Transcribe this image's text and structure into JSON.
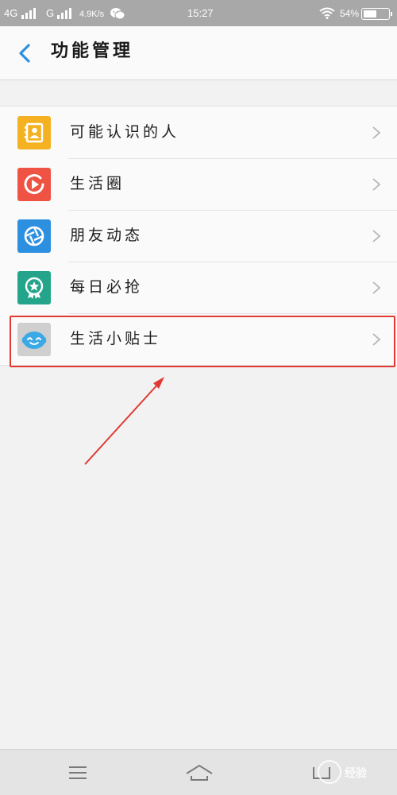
{
  "status_bar": {
    "network1": "4G",
    "network2": "G",
    "speed": "4.9K/s",
    "time": "15:27",
    "battery": "54%",
    "battery_level": 0.54,
    "icons": [
      "signal-icon",
      "signal-icon",
      "wechat-icon",
      "wifi-icon",
      "battery-icon"
    ]
  },
  "header": {
    "back_icon": "chevron-left-icon",
    "title": "功能管理"
  },
  "list": {
    "items": [
      {
        "label": "可能认识的人",
        "icon": "contacts-icon",
        "color": "#f4b223"
      },
      {
        "label": "生活圈",
        "icon": "play-circle-icon",
        "color": "#ee5343"
      },
      {
        "label": "朋友动态",
        "icon": "aperture-icon",
        "color": "#2d8fe0"
      },
      {
        "label": "每日必抢",
        "icon": "badge-star-icon",
        "color": "#24a48a"
      },
      {
        "label": "生活小贴士",
        "icon": "smiley-face-icon",
        "color": "#cfcfcf"
      }
    ],
    "chevron_icon": "chevron-right-icon"
  },
  "annotation": {
    "highlight_color": "#e03a35"
  },
  "nav": {
    "icons": [
      "menu-icon",
      "home-icon",
      "back-icon"
    ]
  },
  "watermark": {
    "text": "经验"
  },
  "colors": {
    "accent": "#2d8fe0",
    "status_bar": "#a8a8a8",
    "background": "#f2f2f2"
  }
}
